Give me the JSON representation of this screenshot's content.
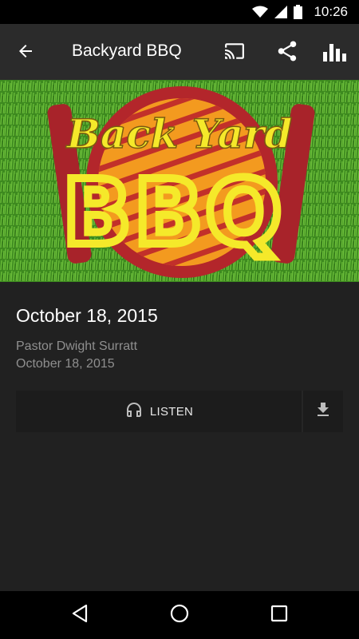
{
  "status_bar": {
    "time": "10:26",
    "icons": [
      "wifi-icon",
      "cell-signal-icon",
      "battery-icon"
    ]
  },
  "toolbar": {
    "title": "Backyard BBQ",
    "icons": [
      "back-arrow-icon",
      "cast-icon",
      "share-icon",
      "stats-icon"
    ]
  },
  "hero": {
    "line1": "Back Yard",
    "line2": "BBQ"
  },
  "details": {
    "title": "October 18, 2015",
    "speaker": "Pastor Dwight Surratt",
    "date": "October 18, 2015"
  },
  "actions": {
    "listen_label": "LISTEN",
    "icons": [
      "headphones-icon",
      "download-icon"
    ]
  },
  "nav_bar": {
    "icons": [
      "back-triangle-icon",
      "home-circle-icon",
      "recents-square-icon"
    ]
  },
  "colors": {
    "background": "#212121",
    "toolbar": "#2b2b2b",
    "grass": "#3f8f1f",
    "grill_red": "#b3262b",
    "grill_orange": "#f39a1f",
    "text_yellow": "#f5e92a"
  }
}
